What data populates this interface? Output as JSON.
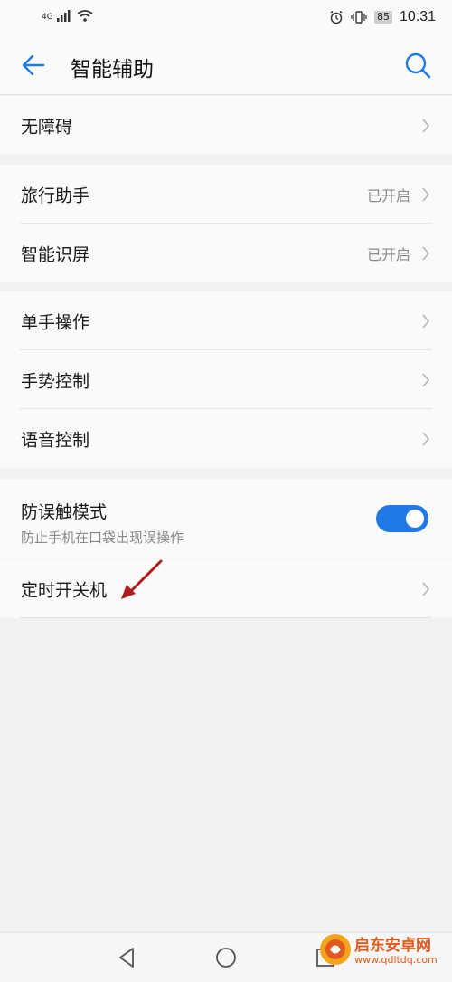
{
  "status_bar": {
    "network": "4G",
    "battery": "85",
    "time": "10:31"
  },
  "header": {
    "title": "智能辅助"
  },
  "groups": [
    {
      "items": [
        {
          "label": "无障碍",
          "value": ""
        }
      ]
    },
    {
      "items": [
        {
          "label": "旅行助手",
          "value": "已开启"
        },
        {
          "label": "智能识屏",
          "value": "已开启"
        }
      ]
    },
    {
      "items": [
        {
          "label": "单手操作",
          "value": ""
        },
        {
          "label": "手势控制",
          "value": ""
        },
        {
          "label": "语音控制",
          "value": ""
        }
      ]
    },
    {
      "toggle": {
        "title": "防误触模式",
        "subtitle": "防止手机在口袋出现误操作",
        "enabled": true
      }
    },
    {
      "items": [
        {
          "label": "定时开关机",
          "value": ""
        }
      ]
    }
  ],
  "watermark": {
    "text": "启东安卓网",
    "url": "www.qdltdq.com"
  },
  "colors": {
    "accent": "#1f7ae8",
    "background": "#f2f2f2",
    "card": "#fafafa",
    "annotation_arrow": "#b01c1c",
    "watermark": "#e15a1c"
  }
}
